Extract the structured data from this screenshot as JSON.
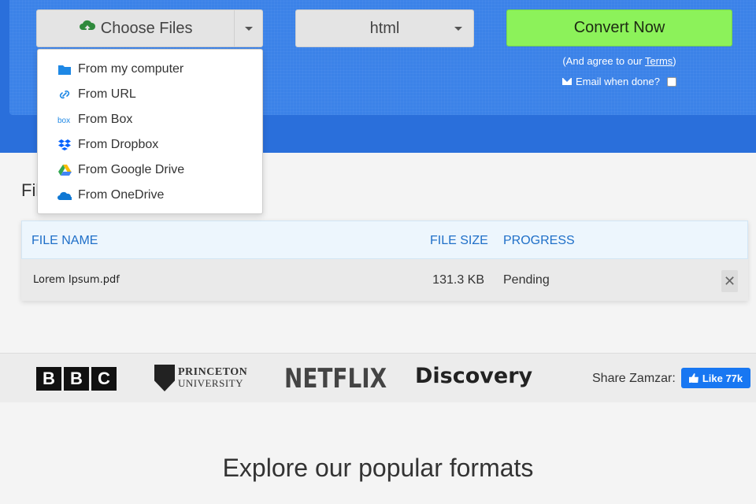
{
  "toolbar": {
    "choose_files_label": "Choose Files",
    "format_value": "html",
    "convert_label": "Convert Now",
    "agree_prefix": "(And agree to our ",
    "agree_link": "Terms",
    "agree_suffix": ")",
    "email_label": "Email when done?"
  },
  "dropdown": {
    "items": [
      {
        "label": "From my computer",
        "icon": "folder-icon"
      },
      {
        "label": "From URL",
        "icon": "link-icon"
      },
      {
        "label": "From Box",
        "icon": "box-icon"
      },
      {
        "label": "From Dropbox",
        "icon": "dropbox-icon"
      },
      {
        "label": "From Google Drive",
        "icon": "google-drive-icon"
      },
      {
        "label": "From OneDrive",
        "icon": "onedrive-icon"
      }
    ]
  },
  "files": {
    "heading": "Fil",
    "columns": {
      "name": "FILE NAME",
      "size": "FILE SIZE",
      "progress": "PROGRESS"
    },
    "rows": [
      {
        "name": "Lorem Ipsum.pdf",
        "size": "131.3 KB",
        "progress": "Pending"
      }
    ]
  },
  "logos": {
    "bbc": [
      "B",
      "B",
      "C"
    ],
    "princeton_line1": "PRINCETON",
    "princeton_line2": "UNIVERSITY",
    "netflix": "NETFLIX",
    "discovery": "Discovery",
    "share_label": "Share Zamzar:",
    "like_label": "Like 77k"
  },
  "explore_heading": "Explore our popular formats",
  "colors": {
    "hero_blue": "#3b82e8",
    "convert_green": "#8cf25a",
    "table_header_text": "#1f6fc8",
    "facebook_blue": "#1877f2"
  }
}
